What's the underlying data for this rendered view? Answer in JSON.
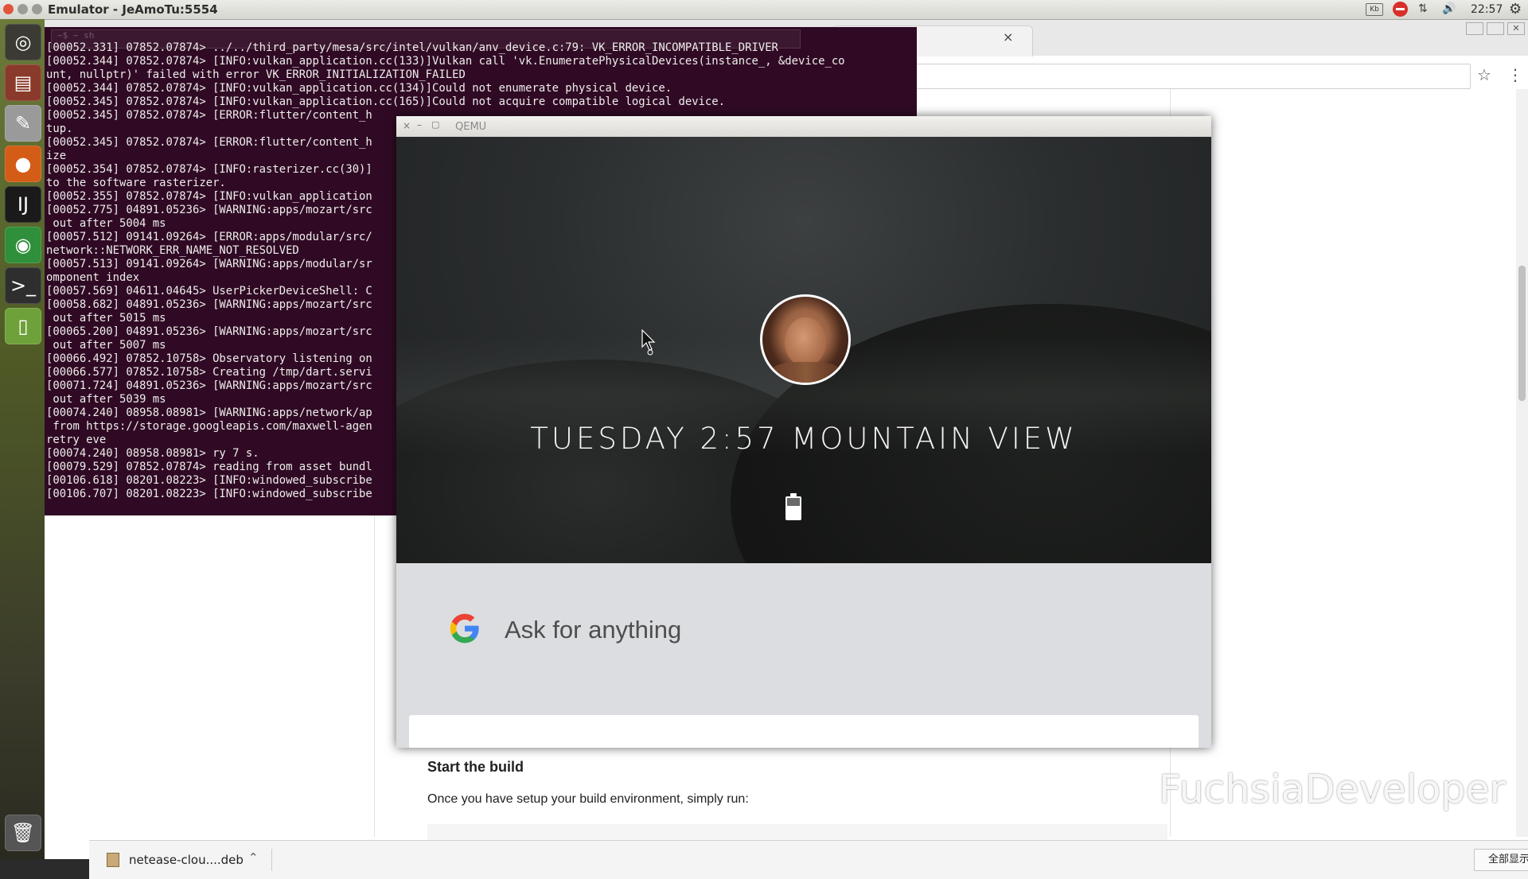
{
  "topbar": {
    "title": "Emulator - JeAmoTu:5554",
    "kbd": "Kb",
    "net": "⇅",
    "vol": "🔊",
    "clock": "22:57",
    "gear": "⚙"
  },
  "launcher": {
    "items": [
      {
        "name": "dash-home",
        "glyph": "◎",
        "color": "#3b3b33"
      },
      {
        "name": "files",
        "glyph": "▤",
        "color": "#8a3a2a"
      },
      {
        "name": "system-settings",
        "glyph": "✎",
        "color": "#9a9a9a"
      },
      {
        "name": "firefox",
        "glyph": "●",
        "color": "#d35c16"
      },
      {
        "name": "intellij",
        "glyph": "IJ",
        "color": "#1a1a1a"
      },
      {
        "name": "chrome",
        "glyph": "◉",
        "color": "#2f8f3a"
      },
      {
        "name": "terminal",
        "glyph": ">_",
        "color": "#2e2e2e"
      },
      {
        "name": "android-emulator",
        "glyph": "▯",
        "color": "#6fa13a"
      },
      {
        "name": "trash",
        "glyph": "🗑",
        "color": "#555"
      }
    ]
  },
  "terminal": {
    "ghost_text": "~$ ~ sh",
    "lines": [
      "[00052.331] 07852.07874> ../../third_party/mesa/src/intel/vulkan/anv_device.c:79: VK_ERROR_INCOMPATIBLE_DRIVER",
      "[00052.344] 07852.07874> [INFO:vulkan_application.cc(133)]Vulkan call 'vk.EnumeratePhysicalDevices(instance_, &device_co",
      "unt, nullptr)' failed with error VK_ERROR_INITIALIZATION_FAILED",
      "[00052.344] 07852.07874> [INFO:vulkan_application.cc(134)]Could not enumerate physical device.",
      "[00052.345] 07852.07874> [INFO:vulkan_application.cc(165)]Could not acquire compatible logical device.",
      "[00052.345] 07852.07874> [ERROR:flutter/content_h",
      "tup.",
      "[00052.345] 07852.07874> [ERROR:flutter/content_h",
      "ize",
      "[00052.354] 07852.07874> [INFO:rasterizer.cc(30)]",
      "to the software rasterizer.",
      "[00052.355] 07852.07874> [INFO:vulkan_application",
      "[00052.775] 04891.05236> [WARNING:apps/mozart/src",
      " out after 5004 ms",
      "[00057.512] 09141.09264> [ERROR:apps/modular/src/",
      "network::NETWORK_ERR_NAME_NOT_RESOLVED",
      "[00057.513] 09141.09264> [WARNING:apps/modular/sr",
      "omponent index",
      "[00057.569] 04611.04645> UserPickerDeviceShell: C",
      "[00058.682] 04891.05236> [WARNING:apps/mozart/src",
      " out after 5015 ms",
      "[00065.200] 04891.05236> [WARNING:apps/mozart/src",
      " out after 5007 ms",
      "[00066.492] 07852.10758> Observatory listening on",
      "[00066.577] 07852.10758> Creating /tmp/dart.servi",
      "[00071.724] 04891.05236> [WARNING:apps/mozart/src",
      " out after 5039 ms",
      "[00074.240] 08958.08981> [WARNING:apps/network/ap",
      " from https://storage.googleapis.com/maxwell-agen",
      "retry eve",
      "[00074.240] 08958.08981> ry 7 s.",
      "[00079.529] 07852.07874> reading from asset bundl",
      "[00106.618] 08201.08223> [INFO:windowed_subscribe",
      "[00106.707] 08201.08223> [INFO:windowed_subscribe"
    ]
  },
  "browser": {
    "tab_close": "×",
    "star": "☆",
    "menu": "⋮",
    "doc_heading": "Start the build",
    "doc_text": "Once you have setup your build environment, simply run:",
    "download_file": "netease-clou....deb",
    "download_chevron": "⌃",
    "show_all": "全部显示",
    "download_close": "✕",
    "window_close": "✕"
  },
  "qemu": {
    "title": "QEMU",
    "close": "×",
    "min": "–",
    "max": "▢",
    "datetime": "TUESDAY 2:57 MOUNTAIN VIEW",
    "ask_placeholder": "Ask for anything"
  },
  "watermark": {
    "text": "FuchsiaDeveloper"
  },
  "colors": {
    "terminal_bg": "#300a24",
    "google_blue": "#4285F4",
    "google_red": "#EA4335",
    "google_yellow": "#FBBC05",
    "google_green": "#34A853",
    "ask_panel_bg": "#dcdde0"
  }
}
